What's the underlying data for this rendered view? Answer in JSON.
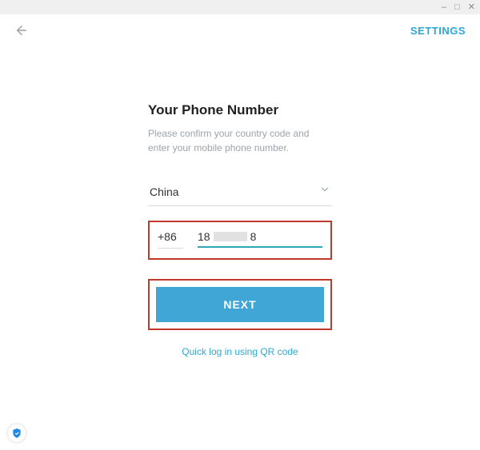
{
  "window": {
    "minimize": "–",
    "maximize": "□",
    "close": "✕"
  },
  "topbar": {
    "settings": "SETTINGS"
  },
  "form": {
    "title": "Your Phone Number",
    "subtitle": "Please confirm your country code and enter your mobile phone number.",
    "country": "China",
    "code": "+86",
    "phone_prefix": "18",
    "phone_suffix": "8",
    "next": "NEXT",
    "qr": "Quick log in using QR code"
  }
}
